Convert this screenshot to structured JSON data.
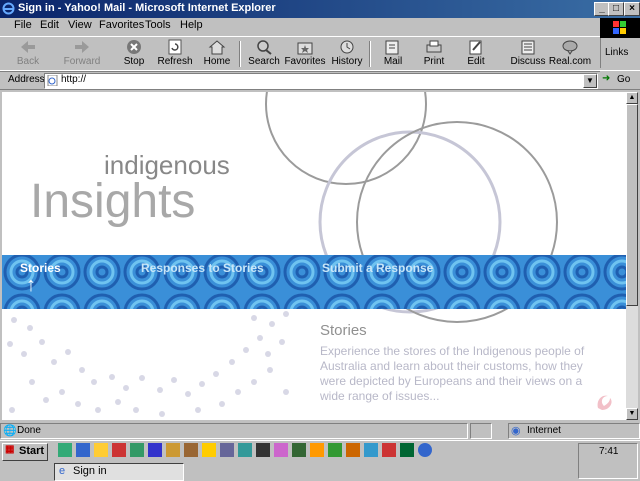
{
  "window": {
    "title": "Sign in - Yahoo! Mail - Microsoft Internet Explorer"
  },
  "menu": [
    "File",
    "Edit",
    "View",
    "Favorites",
    "Tools",
    "Help"
  ],
  "toolbar": [
    {
      "label": "Back",
      "icon": "back-arrow-icon",
      "enabled": false
    },
    {
      "label": "Forward",
      "icon": "forward-arrow-icon",
      "enabled": false
    },
    {
      "label": "Stop",
      "icon": "stop-icon",
      "enabled": true
    },
    {
      "label": "Refresh",
      "icon": "refresh-icon",
      "enabled": true
    },
    {
      "label": "Home",
      "icon": "home-icon",
      "enabled": true
    },
    {
      "label": "Search",
      "icon": "search-icon",
      "enabled": true
    },
    {
      "label": "Favorites",
      "icon": "favorites-icon",
      "enabled": true
    },
    {
      "label": "History",
      "icon": "history-icon",
      "enabled": true
    },
    {
      "label": "Mail",
      "icon": "mail-icon",
      "enabled": true
    },
    {
      "label": "Print",
      "icon": "print-icon",
      "enabled": true
    },
    {
      "label": "Edit",
      "icon": "edit-icon",
      "enabled": true
    },
    {
      "label": "Discuss",
      "icon": "discuss-icon",
      "enabled": true
    },
    {
      "label": "Real.com",
      "icon": "real-icon",
      "enabled": true
    }
  ],
  "links_label": "Links",
  "address": {
    "label": "Address",
    "value": "http://",
    "go_label": "Go"
  },
  "page": {
    "brand_small": "indigenous",
    "brand_large": "Insights",
    "nav": [
      {
        "label": "Stories",
        "active": true
      },
      {
        "label": "Responses to Stories",
        "active": false
      },
      {
        "label": "Submit a Response",
        "active": false
      }
    ],
    "section_title": "Stories",
    "section_text": "Experience the stores of the Indigenous people of Australia and learn about their customs, how they were depicted by Europeans and their views on a wide range of issues...",
    "colors": {
      "band": "#3a8fd8",
      "band_dark": "#2a5fb8",
      "text_grey": "#b8b8c8",
      "title_grey": "#909090"
    }
  },
  "status": {
    "text": "Done",
    "zone": "Internet"
  },
  "taskbar": {
    "start": "Start",
    "task": "Sign in",
    "clock": "7:41"
  }
}
